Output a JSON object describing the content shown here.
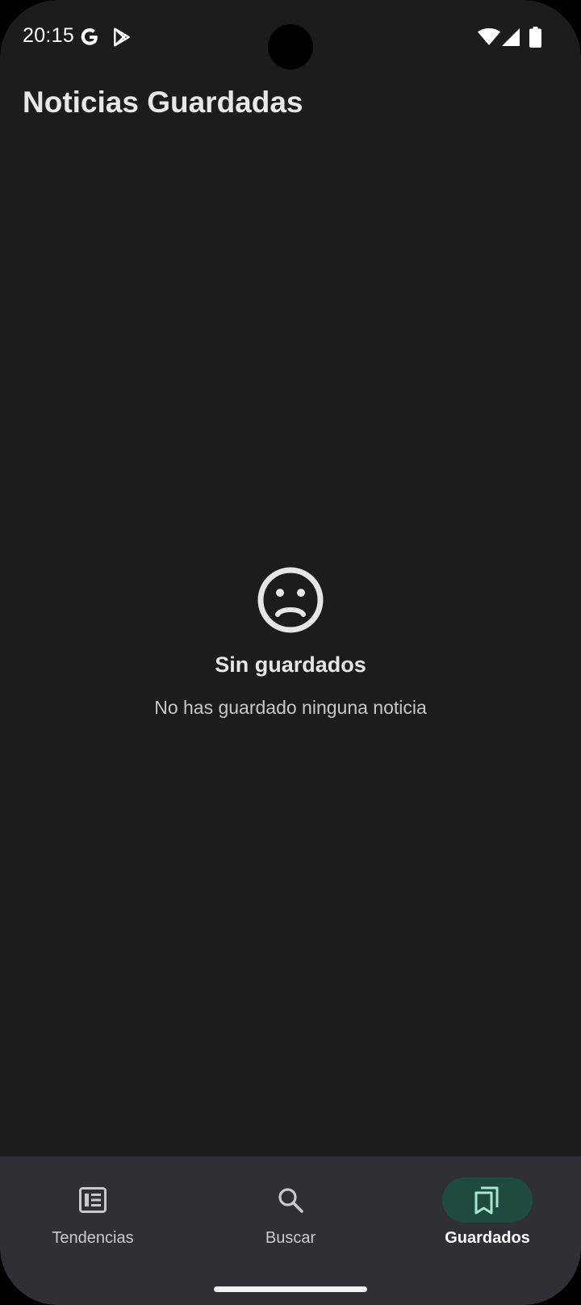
{
  "status_bar": {
    "time": "20:15",
    "icons": [
      "google-g-icon",
      "play-store-icon",
      "wifi-icon",
      "signal-icon",
      "battery-icon"
    ]
  },
  "header": {
    "title": "Noticias Guardadas"
  },
  "empty_state": {
    "icon": "sad-face-icon",
    "title": "Sin guardados",
    "subtitle": "No has guardado ninguna noticia"
  },
  "bottom_nav": {
    "items": [
      {
        "label": "Tendencias",
        "icon": "newspaper-icon",
        "active": false
      },
      {
        "label": "Buscar",
        "icon": "search-icon",
        "active": false
      },
      {
        "label": "Guardados",
        "icon": "bookmarks-icon",
        "active": true
      }
    ],
    "active_color": "#1e4a40",
    "accent_icon_color": "#a8e6cf"
  },
  "colors": {
    "background": "#1b1c1e",
    "nav_background": "#2e3035",
    "text_primary": "#e6e6e8"
  }
}
